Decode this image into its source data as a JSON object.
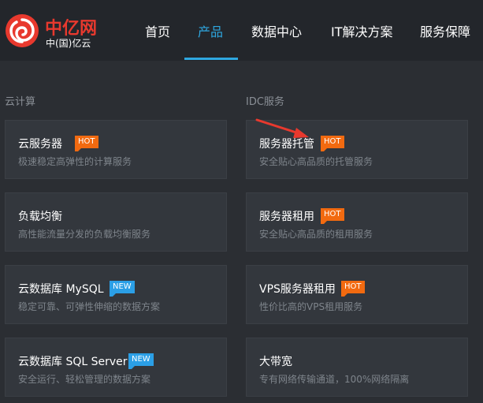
{
  "logo": {
    "name": "中亿网",
    "subtitle": "中(国)亿云",
    "brand_color": "#e8392e"
  },
  "nav": {
    "items": [
      {
        "label": "首页",
        "active": false
      },
      {
        "label": "产品",
        "active": true
      },
      {
        "label": "数据中心",
        "active": false
      },
      {
        "label": "IT解决方案",
        "active": false
      },
      {
        "label": "服务保障",
        "active": false
      }
    ],
    "active_color": "#2ea7e0"
  },
  "sections": [
    {
      "title": "云计算",
      "cards": [
        {
          "title": "云服务器",
          "badge": "HOT",
          "desc": "极速稳定高弹性的计算服务"
        },
        {
          "title": "负载均衡",
          "badge": "",
          "desc": "高性能流量分发的负载均衡服务"
        },
        {
          "title": "云数据库 MySQL",
          "badge": "NEW",
          "desc": "稳定可靠、可弹性伸缩的数据方案"
        },
        {
          "title": "云数据库 SQL Server",
          "badge": "NEW",
          "desc": "安全运行、轻松管理的数据方案"
        }
      ]
    },
    {
      "title": "IDC服务",
      "cards": [
        {
          "title": "服务器托管",
          "badge": "HOT",
          "desc": "安全贴心高品质的托管服务"
        },
        {
          "title": "服务器租用",
          "badge": "HOT",
          "desc": "安全贴心高品质的租用服务"
        },
        {
          "title": "VPS服务器租用",
          "badge": "HOT",
          "desc": "性价比高的VPS租用服务"
        },
        {
          "title": "大带宽",
          "badge": "",
          "desc": "专有网络传输通道，100%网络隔离"
        }
      ]
    }
  ],
  "colors": {
    "hot_badge": "#f26a10",
    "new_badge": "#2b9fe6",
    "annotation_arrow": "#e8392e"
  }
}
